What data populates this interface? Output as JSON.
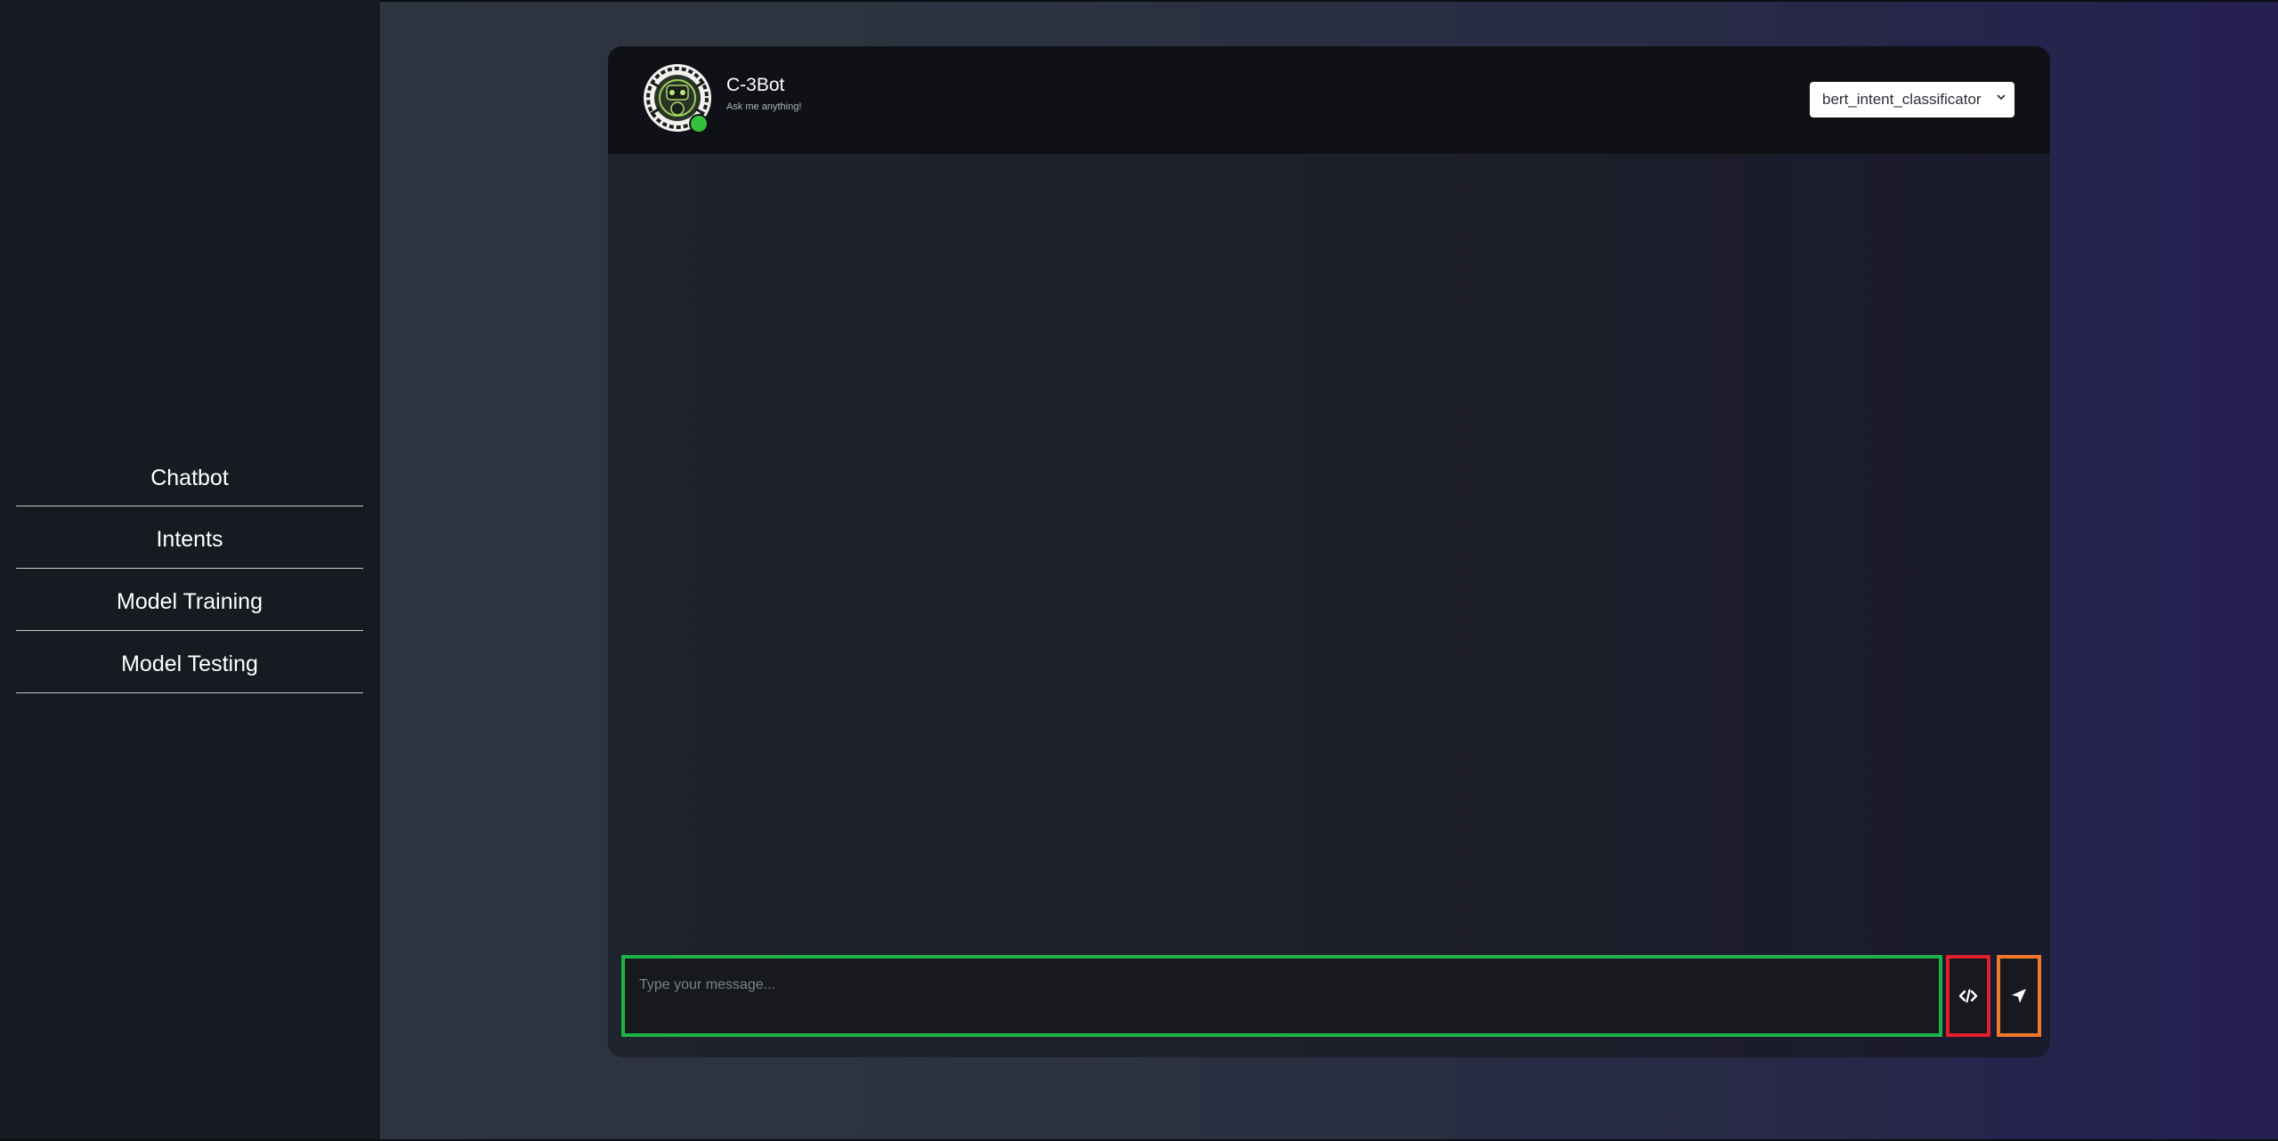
{
  "sidebar": {
    "items": [
      {
        "label": "Chatbot"
      },
      {
        "label": "Intents"
      },
      {
        "label": "Model Training"
      },
      {
        "label": "Model Testing"
      }
    ]
  },
  "chat": {
    "bot_name": "C-3Bot",
    "tagline": "Ask me anything!",
    "status": "online",
    "model_select": {
      "selected": "bert_intent_classificator"
    },
    "input": {
      "placeholder": "Type your message...",
      "value": ""
    },
    "buttons": {
      "code_icon": "code-icon",
      "send_icon": "send-icon"
    }
  },
  "colors": {
    "online": "#34c23a",
    "input_border": "#1fb24a",
    "code_border": "#e0202a",
    "send_border": "#f0782a"
  }
}
